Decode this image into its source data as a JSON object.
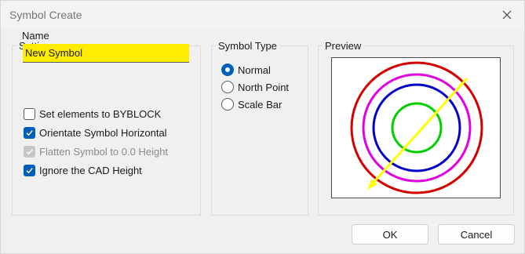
{
  "window": {
    "title": "Symbol Create",
    "close_icon": "close-icon"
  },
  "settings": {
    "group_label": "Settings",
    "name_label": "Name",
    "name_value": "New Symbol",
    "options": [
      {
        "label": "Set elements to BYBLOCK",
        "checked": false,
        "disabled": false
      },
      {
        "label": "Orientate Symbol Horizontal",
        "checked": true,
        "disabled": false
      },
      {
        "label": "Flatten Symbol to 0.0 Height",
        "checked": true,
        "disabled": true
      },
      {
        "label": "Ignore the CAD Height",
        "checked": true,
        "disabled": false
      }
    ]
  },
  "symbol_type": {
    "group_label": "Symbol Type",
    "options": [
      {
        "label": "Normal",
        "selected": true
      },
      {
        "label": "North Point",
        "selected": false
      },
      {
        "label": "Scale Bar",
        "selected": false
      }
    ]
  },
  "preview": {
    "group_label": "Preview",
    "circle_colors": [
      "#d40000",
      "#e000e0",
      "#0000c8",
      "#00d000"
    ],
    "arrow_color": "#ffff00"
  },
  "buttons": {
    "ok_label": "OK",
    "cancel_label": "Cancel"
  },
  "colors": {
    "accent": "#005fb8",
    "name_highlight": "#ffec00"
  }
}
